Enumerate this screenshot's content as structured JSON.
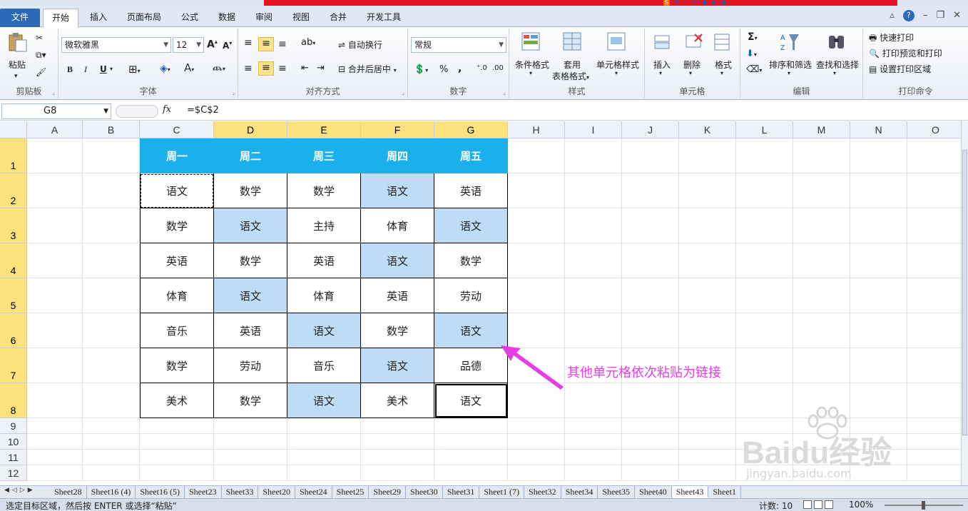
{
  "ribbon_tabs": [
    "文件",
    "开始",
    "插入",
    "页面布局",
    "公式",
    "数据",
    "审阅",
    "视图",
    "合并",
    "开发工具"
  ],
  "ribbon": {
    "clipboard": {
      "label": "剪贴板",
      "paste": "粘贴"
    },
    "font": {
      "label": "字体",
      "name": "微软雅黑",
      "size": "12",
      "bold": "B",
      "italic": "I",
      "underline": "U"
    },
    "align": {
      "label": "对齐方式",
      "wrap": "自动换行",
      "merge": "合并后居中"
    },
    "number": {
      "label": "数字",
      "format": "常规",
      "percent": "%",
      "comma": ","
    },
    "styles": {
      "label": "样式",
      "conditional": "条件格式",
      "table1": "套用",
      "table2": "表格格式",
      "cellstyle": "单元格样式"
    },
    "cells": {
      "label": "单元格",
      "insert": "插入",
      "delete": "删除",
      "format": "格式"
    },
    "edit": {
      "label": "编辑",
      "sort": "排序和筛选",
      "find": "查找和选择",
      "sigma": "Σ"
    },
    "print": {
      "label": "打印命令",
      "quick": "快速打印",
      "preview": "打印预览和打印",
      "area": "设置打印区域"
    }
  },
  "formula_bar": {
    "name_box": "G8",
    "fx": "fx",
    "formula": "=$C$2"
  },
  "columns": [
    "A",
    "B",
    "C",
    "D",
    "E",
    "F",
    "G",
    "H",
    "I",
    "J",
    "K",
    "L",
    "M",
    "N",
    "O"
  ],
  "rows": [
    "1",
    "2",
    "3",
    "4",
    "5",
    "6",
    "7",
    "8",
    "9",
    "10",
    "11",
    "12"
  ],
  "table": {
    "headers": [
      "周一",
      "周二",
      "周三",
      "周四",
      "周五"
    ],
    "body": [
      [
        "语文",
        "数学",
        "数学",
        "语文",
        "英语"
      ],
      [
        "数学",
        "语文",
        "主持",
        "体育",
        "语文"
      ],
      [
        "英语",
        "数学",
        "英语",
        "语文",
        "数学"
      ],
      [
        "体育",
        "语文",
        "体育",
        "英语",
        "劳动"
      ],
      [
        "音乐",
        "英语",
        "语文",
        "数学",
        "语文"
      ],
      [
        "数学",
        "劳动",
        "音乐",
        "语文",
        "品德"
      ],
      [
        "美术",
        "数学",
        "语文",
        "美术",
        "语文"
      ]
    ],
    "highlight_color": "#bfdcf7",
    "header_color": "#1ab0ec"
  },
  "annotation": "其他单元格依次粘贴为链接",
  "watermark": {
    "main": "Baidu经验",
    "sub": "jingyan.baidu.com"
  },
  "sheet_tabs": [
    "Sheet28",
    "Sheet16 (4)",
    "Sheet16 (5)",
    "Sheet23",
    "Sheet33",
    "Sheet20",
    "Sheet24",
    "Sheet25",
    "Sheet29",
    "Sheet30",
    "Sheet31",
    "Sheet1 (7)",
    "Sheet32",
    "Sheet34",
    "Sheet35",
    "Sheet40",
    "Sheet43",
    "Sheet1"
  ],
  "active_sheet": "Sheet43",
  "status": {
    "message": "选定目标区域，然后按 ENTER 或选择“粘贴”",
    "count": "计数: 10",
    "zoom": "100%"
  }
}
